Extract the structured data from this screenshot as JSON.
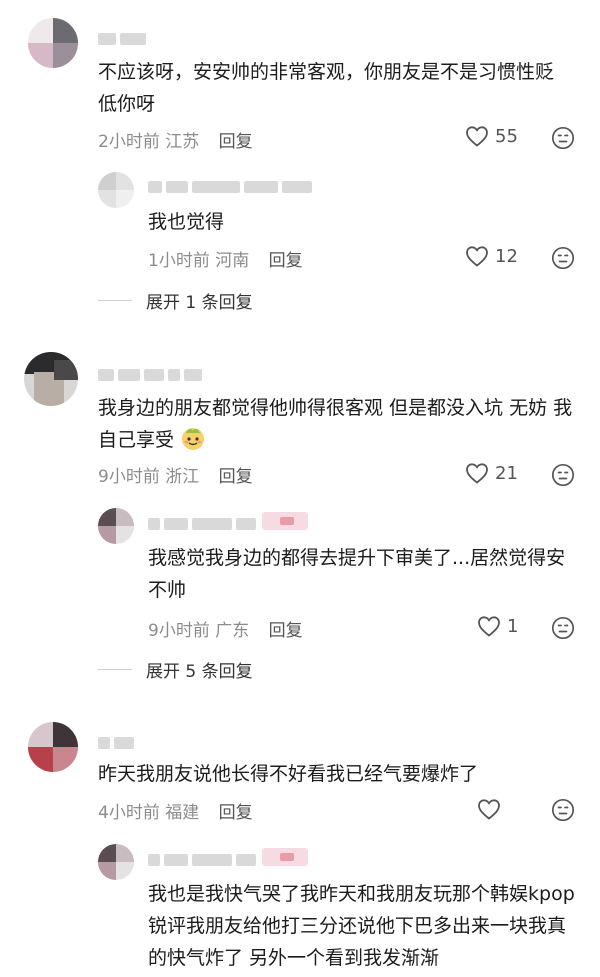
{
  "comments": [
    {
      "text": "不应该呀，安安帅的非常客观，你朋友是不是习惯性贬低你呀",
      "time": "2小时前",
      "location": "江苏",
      "reply_label": "回复",
      "likes": "55",
      "replies": [
        {
          "text": "我也觉得",
          "time": "1小时前",
          "location": "河南",
          "reply_label": "回复",
          "likes": "12"
        }
      ],
      "expand_label": "展开 1 条回复"
    },
    {
      "text": "我身边的朋友都觉得他帅得很客观 但是都没入坑 无妨 我自己享受",
      "time": "9小时前",
      "location": "浙江",
      "reply_label": "回复",
      "likes": "21",
      "replies": [
        {
          "text": "我感觉我身边的都得去提升下审美了...居然觉得安不帅",
          "time": "9小时前",
          "location": "广东",
          "reply_label": "回复",
          "likes": "1"
        }
      ],
      "expand_label": "展开 5 条回复"
    },
    {
      "text": "昨天我朋友说他长得不好看我已经气要爆炸了",
      "time": "4小时前",
      "location": "福建",
      "reply_label": "回复",
      "likes": "",
      "replies": [
        {
          "text": "我也是我快气哭了我昨天和我朋友玩那个韩娱kpop锐评我朋友给他打三分还说他下巴多出来一块我真的快气炸了 另外一个看到我发渐渐"
        }
      ]
    }
  ],
  "icons": {
    "like": "heart-outline-icon",
    "dislike": "unhappy-face-icon",
    "emoji": "smiling-mascot-emoji"
  },
  "colors": {
    "text": "#1c1c1c",
    "meta": "#8c8c8c",
    "icon": "#555555"
  }
}
